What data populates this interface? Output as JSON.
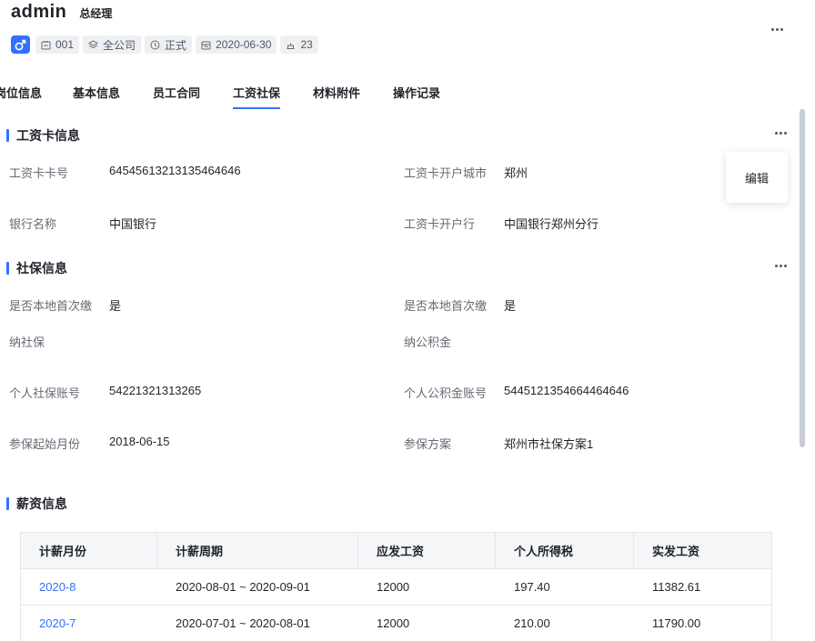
{
  "header": {
    "name": "admin",
    "title": "总经理",
    "chips": [
      {
        "icon": "badge-icon",
        "text": "001"
      },
      {
        "icon": "layers-icon",
        "text": "全公司"
      },
      {
        "icon": "clock-icon",
        "text": "正式"
      },
      {
        "icon": "calendar-icon",
        "text": "2020-06-30"
      },
      {
        "icon": "cake-icon",
        "text": "23"
      }
    ]
  },
  "tabs": [
    "岗位信息",
    "基本信息",
    "员工合同",
    "工资社保",
    "材料附件",
    "操作记录"
  ],
  "active_tab": "工资社保",
  "salary_card": {
    "title": "工资卡信息",
    "fields": {
      "card_no": {
        "label": "工资卡卡号",
        "value": "64545613213135464646"
      },
      "city": {
        "label": "工资卡开户城市",
        "value": "郑州"
      },
      "bank": {
        "label": "银行名称",
        "value": "中国银行"
      },
      "branch": {
        "label": "工资卡开户行",
        "value": "中国银行郑州分行"
      }
    }
  },
  "popover": {
    "edit": "编辑"
  },
  "social": {
    "title": "社保信息",
    "fields": {
      "first_local_left": {
        "label": "是否本地首次缴",
        "value": "是"
      },
      "first_local_right": {
        "label": "是否本地首次缴",
        "value": "是"
      },
      "social_insurance": {
        "label": "纳社保",
        "value": ""
      },
      "housing_fund": {
        "label": "纳公积金",
        "value": ""
      },
      "social_account": {
        "label": "个人社保账号",
        "value": "54221321313265"
      },
      "fund_account": {
        "label": "个人公积金账号",
        "value": "5445121354664464646"
      },
      "start_month": {
        "label": "参保起始月份",
        "value": "2018-06-15"
      },
      "plan": {
        "label": "参保方案",
        "value": "郑州市社保方案1"
      }
    }
  },
  "salary": {
    "title": "薪资信息",
    "columns": [
      "计薪月份",
      "计薪周期",
      "应发工资",
      "个人所得税",
      "实发工资"
    ],
    "rows": [
      [
        "2020-8",
        "2020-08-01 ~ 2020-09-01",
        "12000",
        "197.40",
        "11382.61"
      ],
      [
        "2020-7",
        "2020-07-01 ~ 2020-08-01",
        "12000",
        "210.00",
        "11790.00"
      ]
    ]
  },
  "colors": {
    "accent": "#3370ff",
    "text": "#1f2329",
    "label": "#646a73"
  }
}
